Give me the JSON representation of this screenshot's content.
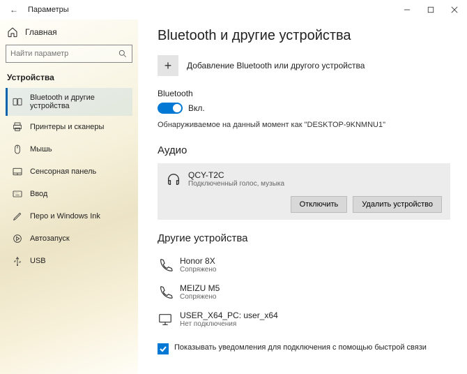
{
  "titlebar": {
    "back_label": "←",
    "title": "Параметры"
  },
  "sidebar": {
    "home_label": "Главная",
    "search_placeholder": "Найти параметр",
    "section_title": "Устройства",
    "items": [
      {
        "label": "Bluetooth и другие устройства",
        "icon": "bluetooth-devices"
      },
      {
        "label": "Принтеры и сканеры",
        "icon": "printer"
      },
      {
        "label": "Мышь",
        "icon": "mouse"
      },
      {
        "label": "Сенсорная панель",
        "icon": "touchpad"
      },
      {
        "label": "Ввод",
        "icon": "keyboard"
      },
      {
        "label": "Перо и Windows Ink",
        "icon": "pen"
      },
      {
        "label": "Автозапуск",
        "icon": "autoplay"
      },
      {
        "label": "USB",
        "icon": "usb"
      }
    ]
  },
  "main": {
    "heading": "Bluetooth и другие устройства",
    "add_device_label": "Добавление Bluetooth или другого устройства",
    "bt_section_label": "Bluetooth",
    "bt_toggle_label": "Вкл.",
    "discoverable_text": "Обнаруживаемое на данный момент как \"DESKTOP-9KNMNU1\"",
    "audio_heading": "Аудио",
    "audio_device": {
      "name": "QCY-T2C",
      "status": "Подключенный голос, музыка",
      "disconnect_label": "Отключить",
      "remove_label": "Удалить устройство"
    },
    "other_heading": "Другие устройства",
    "other_devices": [
      {
        "name": "Honor 8X",
        "status": "Сопряжено",
        "icon": "phone"
      },
      {
        "name": "MEIZU M5",
        "status": "Сопряжено",
        "icon": "phone"
      },
      {
        "name": "USER_X64_PC: user_x64",
        "status": "Нет подключения",
        "icon": "pc"
      }
    ],
    "notify_label": "Показывать уведомления для подключения с помощью быстрой связи"
  }
}
